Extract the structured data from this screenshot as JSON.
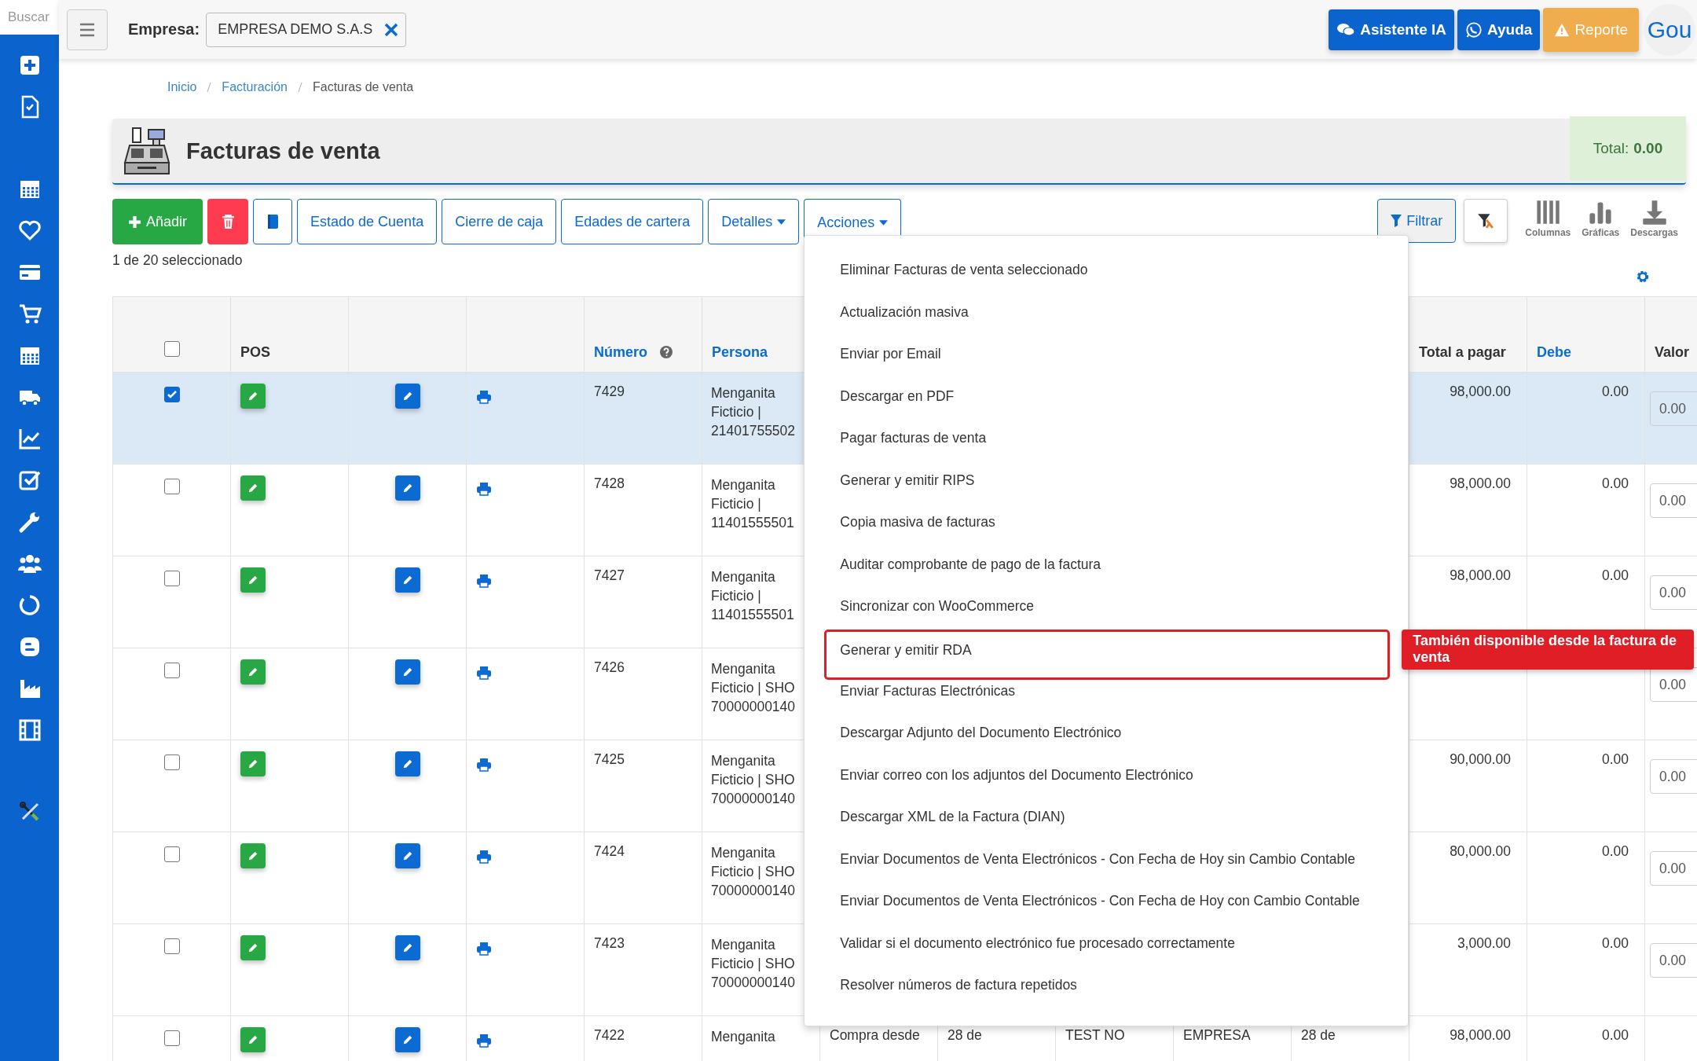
{
  "sidebar": {
    "search": {
      "placeholder": "Buscar"
    }
  },
  "topbar": {
    "company_label": "Empresa:",
    "company_value": "EMPRESA DEMO S.A.S",
    "buttons": [
      {
        "kind": "assistant",
        "label": "Asistente IA"
      },
      {
        "kind": "help",
        "label": "Ayuda"
      },
      {
        "kind": "report",
        "label": "Reporte"
      }
    ],
    "avatar_text": "Gou"
  },
  "breadcrumb": [
    {
      "label": "Inicio",
      "link": true
    },
    {
      "label": "Facturación",
      "link": true
    },
    {
      "label": "Facturas de venta",
      "link": false
    }
  ],
  "header": {
    "title": "Facturas de venta",
    "total_label": "Total:",
    "total_value": "0.00"
  },
  "toolbar": [
    {
      "kind": "add",
      "label": "Añadir"
    },
    {
      "kind": "delete"
    },
    {
      "kind": "book"
    },
    {
      "kind": "outline",
      "label": "Estado de Cuenta"
    },
    {
      "kind": "outline",
      "label": "Cierre de caja"
    },
    {
      "kind": "outline",
      "label": "Edades de cartera"
    },
    {
      "kind": "dropdown",
      "label": "Detalles",
      "expanded": false
    },
    {
      "kind": "dropdown",
      "label": "Acciones",
      "expanded": true
    }
  ],
  "tools": [
    {
      "kind": "filter",
      "label": "Filtrar"
    },
    {
      "kind": "clear_filter"
    },
    {
      "kind": "columns",
      "label": "Columnas"
    },
    {
      "kind": "charts",
      "label": "Gráficas"
    },
    {
      "kind": "downloads",
      "label": "Descargas"
    }
  ],
  "selection_text": "1 de 20 seleccionado",
  "actions_menu": {
    "items": [
      {
        "label": "Eliminar Facturas de venta seleccionado",
        "highlighted": false
      },
      {
        "label": "Actualización masiva",
        "highlighted": false
      },
      {
        "label": "Enviar por Email",
        "highlighted": false
      },
      {
        "label": "Descargar en PDF",
        "highlighted": false
      },
      {
        "label": "Pagar facturas de venta",
        "highlighted": false
      },
      {
        "label": "Generar y emitir RIPS",
        "highlighted": false
      },
      {
        "label": "Copia masiva de facturas",
        "highlighted": false
      },
      {
        "label": "Auditar comprobante de pago de la factura",
        "highlighted": false
      },
      {
        "label": "Sincronizar con WooCommerce",
        "highlighted": false
      },
      {
        "label": "Generar y emitir RDA",
        "highlighted": true
      },
      {
        "label": "Enviar Facturas Electrónicas",
        "highlighted": false
      },
      {
        "label": "Descargar Adjunto del Documento Electrónico",
        "highlighted": false
      },
      {
        "label": "Enviar correo con los adjuntos del Documento Electrónico",
        "highlighted": false
      },
      {
        "label": "Descargar XML de la Factura (DIAN)",
        "highlighted": false
      },
      {
        "label": "Enviar Documentos de Venta Electrónicos - Con Fecha de Hoy sin Cambio Contable",
        "highlighted": false
      },
      {
        "label": "Enviar Documentos de Venta Electrónicos - Con Fecha de Hoy con Cambio Contable",
        "highlighted": false
      },
      {
        "label": "Validar si el documento electrónico fue procesado correctamente",
        "highlighted": false
      },
      {
        "label": "Resolver números de factura repetidos",
        "highlighted": false
      }
    ],
    "callout": "También disponible desde la factura de venta"
  },
  "table": {
    "select_all": {
      "checked": false
    },
    "columns": [
      {
        "label": "POS",
        "link": false
      },
      {
        "label": "Número",
        "link": true,
        "help": true
      },
      {
        "label": "Persona",
        "link": true
      },
      {
        "label": "Total a pagar",
        "link": false
      },
      {
        "label": "Debe",
        "link": true
      },
      {
        "label": "Valor",
        "link": false
      }
    ],
    "rows": [
      {
        "selected": true,
        "numero": "7429",
        "persona": [
          "Menganita",
          "Ficticio |",
          "21401755502"
        ],
        "total": "98,000.00",
        "debe": "0.00",
        "valor": "0.00"
      },
      {
        "selected": false,
        "numero": "7428",
        "persona": [
          "Menganita",
          "Ficticio |",
          "11401555501"
        ],
        "total": "98,000.00",
        "debe": "0.00",
        "valor": "0.00"
      },
      {
        "selected": false,
        "numero": "7427",
        "persona": [
          "Menganita",
          "Ficticio |",
          "11401555501"
        ],
        "total": "98,000.00",
        "debe": "0.00",
        "valor": "0.00"
      },
      {
        "selected": false,
        "numero": "7426",
        "persona": [
          "Menganita",
          "Ficticio | SHO",
          "70000000140"
        ],
        "valor": "0.00"
      },
      {
        "selected": false,
        "numero": "7425",
        "persona": [
          "Menganita",
          "Ficticio | SHO",
          "70000000140"
        ],
        "total": "90,000.00",
        "debe": "0.00",
        "valor": "0.00"
      },
      {
        "selected": false,
        "numero": "7424",
        "persona": [
          "Menganita",
          "Ficticio | SHO",
          "70000000140"
        ],
        "total": "80,000.00",
        "debe": "0.00",
        "valor": "0.00"
      },
      {
        "selected": false,
        "numero": "7423",
        "persona": [
          "Menganita",
          "Ficticio | SHO",
          "70000000140"
        ],
        "total": "3,000.00",
        "debe": "0.00",
        "valor": "0.00"
      },
      {
        "selected": false,
        "numero": "7422",
        "persona": [
          "Menganita"
        ],
        "hidden_cells": [
          "Compra desde",
          "28 de",
          "TEST NO",
          "EMPRESA",
          "28 de"
        ],
        "total": "98,000.00",
        "debe": "0.00"
      }
    ]
  }
}
